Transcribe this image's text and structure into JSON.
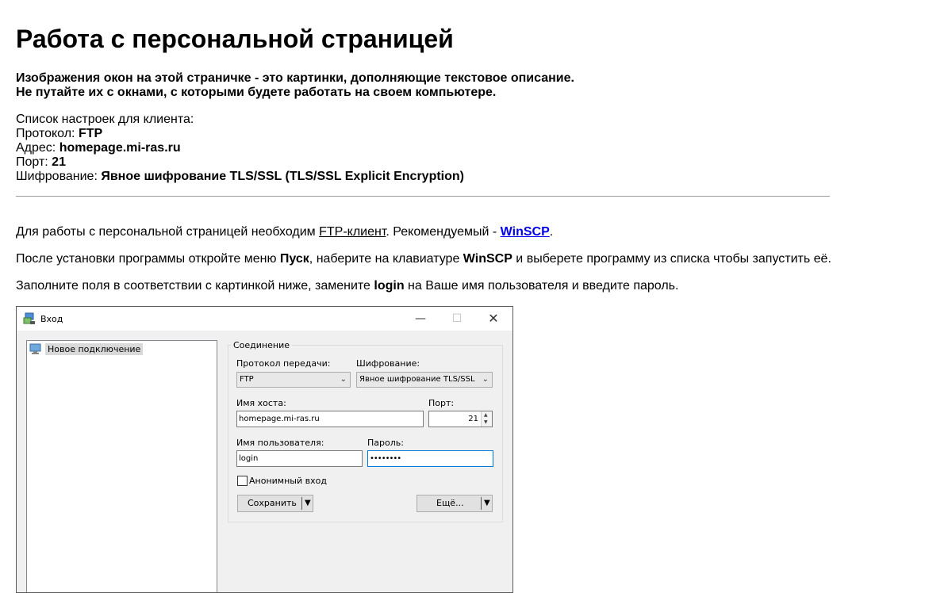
{
  "title": "Работа с персональной страницей",
  "notice": {
    "line1": "Изображения окон на этой страничке - это картинки, дополняющие текстовое описание.",
    "line2": "Не путайте их с окнами, с которыми будете работать на своем компьютере."
  },
  "settings": {
    "heading": "Список настроек для клиента:",
    "protocol_label": "Протокол: ",
    "protocol_value": "FTP",
    "address_label": "Адрес: ",
    "address_value": "homepage.mi-ras.ru",
    "port_label": "Порт: ",
    "port_value": "21",
    "encryption_label": "Шифрование: ",
    "encryption_value": "Явное шифрование TLS/SSL (TLS/SSL Explicit Encryption)"
  },
  "para1": {
    "before": "Для работы с персональной страницей необходим ",
    "link1": "FTP-клиент",
    "middle": ". Рекомендуемый - ",
    "link2": "WinSCP",
    "after": "."
  },
  "para2": {
    "t1": "После установки программы откройте меню ",
    "b1": "Пуск",
    "t2": ", наберите на клавиатуре ",
    "b2": "WinSCP",
    "t3": " и выберете программу из списка чтобы запустить её."
  },
  "para3": {
    "t1": "Заполните поля в соответствии с картинкой ниже, замените ",
    "b1": "login",
    "t2": " на Ваше имя пользователя и введите пароль."
  },
  "dialog": {
    "title": "Вход",
    "tree_item": "Новое подключение",
    "group_title": "Соединение",
    "protocol_label": "Протокол передачи:",
    "protocol_value": "FTP",
    "encryption_label": "Шифрование:",
    "encryption_value": "Явное шифрование TLS/SSL",
    "host_label": "Имя хоста:",
    "host_value": "homepage.mi-ras.ru",
    "port_label": "Порт:",
    "port_value": "21",
    "user_label": "Имя пользователя:",
    "user_value": "login",
    "password_label": "Пароль:",
    "password_value": "••••••••",
    "anon_label": "Анонимный вход",
    "anon_checked": false,
    "save_button": "Сохранить",
    "more_button": "Ещё..."
  },
  "colors": {
    "link": "#0000ee",
    "focus_border": "#0078d7"
  }
}
